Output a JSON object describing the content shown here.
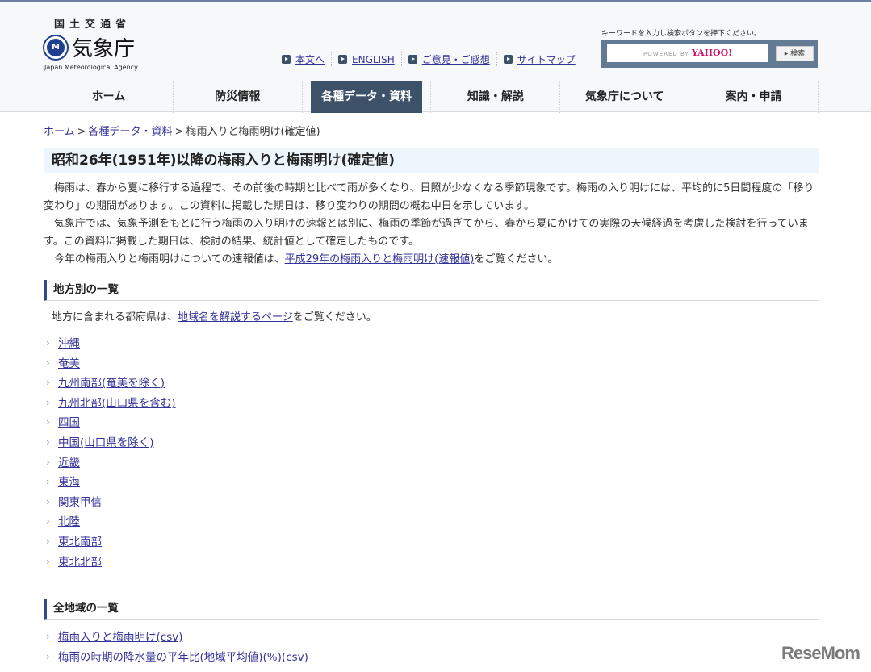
{
  "header": {
    "ministry": "国土交通省",
    "agency": "気象庁",
    "agency_en": "Japan Meteorological Agency",
    "top_links": [
      "本文へ",
      "ENGLISH",
      "ご意見・ご感想",
      "サイトマップ"
    ],
    "search_hint": "キーワードを入力し検索ボタンを押下ください。",
    "search_powered": "POWERED BY",
    "search_brand": "YAHOO!",
    "search_button": "▸ 検索"
  },
  "nav": {
    "items": [
      "ホーム",
      "防災情報",
      "各種データ・資料",
      "知識・解説",
      "気象庁について",
      "案内・申請"
    ],
    "active": "各種データ・資料"
  },
  "breadcrumb": {
    "home": "ホーム",
    "sep": ">",
    "section": "各種データ・資料",
    "current": "梅雨入りと梅雨明け(確定値)"
  },
  "page_title": "昭和26年(1951年)以降の梅雨入りと梅雨明け(確定値)",
  "intro": {
    "p1": "梅雨は、春から夏に移行する過程で、その前後の時期と比べて雨が多くなり、日照が少なくなる季節現象です。梅雨の入り明けには、平均的に5日間程度の「移り変わり」の期間があります。この資料に掲載した期日は、移り変わりの期間の概ね中日を示しています。",
    "p2": "気象庁では、気象予測をもとに行う梅雨の入り明けの速報とは別に、梅雨の季節が過ぎてから、春から夏にかけての実際の天候経過を考慮した検討を行っています。この資料に掲載した期日は、検討の結果、統計値として確定したものです。",
    "p3_before": "今年の梅雨入りと梅雨明けについての速報値は、",
    "p3_link": "平成29年の梅雨入りと梅雨明け(速報値)",
    "p3_after": "をご覧ください。"
  },
  "regional": {
    "heading": "地方別の一覧",
    "note_before": "地方に含まれる都府県は、",
    "note_link": "地域名を解説するページ",
    "note_after": "をご覧ください。",
    "items": [
      "沖縄",
      "奄美",
      "九州南部(奄美を除く)",
      "九州北部(山口県を含む)",
      "四国",
      "中国(山口県を除く)",
      "近畿",
      "東海",
      "関東甲信",
      "北陸",
      "東北南部",
      "東北北部"
    ]
  },
  "all": {
    "heading": "全地域の一覧",
    "items": [
      "梅雨入りと梅雨明け(csv)",
      "梅雨の時期の降水量の平年比(地域平均値)(%)(csv)"
    ]
  },
  "watermark": "ReseMom"
}
